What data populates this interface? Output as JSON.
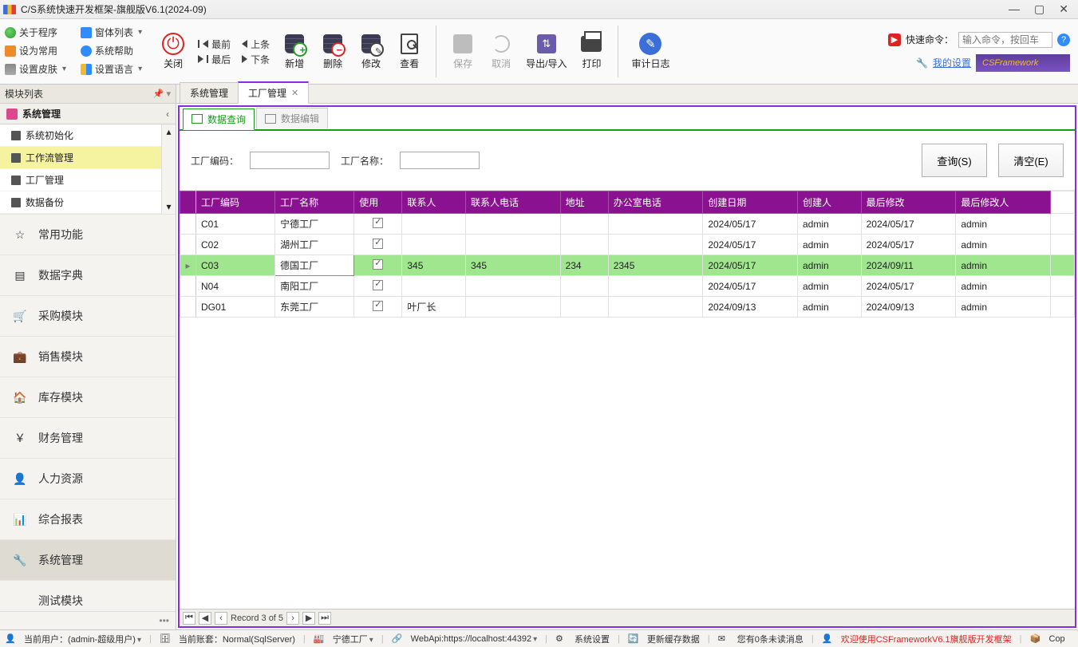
{
  "window": {
    "title": "C/S系统快速开发框架-旗舰版V6.1(2024-09)"
  },
  "menubar": {
    "left": {
      "about": "关于程序",
      "formlist": "窗体列表",
      "setcommon": "设为常用",
      "help": "系统帮助",
      "skin": "设置皮肤",
      "lang": "设置语言"
    },
    "close": "关闭",
    "nav": {
      "first": "最前",
      "prev": "上条",
      "last": "最后",
      "next": "下条"
    },
    "tools": {
      "add": "新增",
      "del": "删除",
      "edit": "修改",
      "view": "查看",
      "save": "保存",
      "cancel": "取消",
      "io": "导出/导入",
      "print": "打印",
      "audit": "审计日志"
    },
    "right": {
      "quickcmd_label": "快速命令：",
      "quickcmd_placeholder": "输入命令，按回车",
      "mysettings": "我的设置",
      "brand": "CSFramework"
    }
  },
  "sidebar": {
    "title": "模块列表",
    "category": "系统管理",
    "tree": [
      "系统初始化",
      "工作流管理",
      "工厂管理",
      "数据备份"
    ],
    "tree_sel": 1,
    "modules": [
      {
        "label": "常用功能",
        "icon": "☆"
      },
      {
        "label": "数据字典",
        "icon": "▤"
      },
      {
        "label": "采购模块",
        "icon": "🛒"
      },
      {
        "label": "销售模块",
        "icon": "💼"
      },
      {
        "label": "库存模块",
        "icon": "🏠"
      },
      {
        "label": "财务管理",
        "icon": "￥"
      },
      {
        "label": "人力资源",
        "icon": "👤"
      },
      {
        "label": "综合报表",
        "icon": "📊"
      },
      {
        "label": "系统管理",
        "icon": "🔧"
      },
      {
        "label": "测试模块",
        "icon": "</>"
      }
    ],
    "active_module": 8
  },
  "tabs": {
    "items": [
      "系统管理",
      "工厂管理"
    ],
    "active": 1
  },
  "subtabs": {
    "query": "数据查询",
    "edit": "数据编辑"
  },
  "search": {
    "code_label": "工厂编码：",
    "name_label": "工厂名称：",
    "query_btn": "查询(S)",
    "clear_btn": "清空(E)"
  },
  "grid": {
    "columns": [
      "工厂编码",
      "工厂名称",
      "使用",
      "联系人",
      "联系人电话",
      "地址",
      "办公室电话",
      "创建日期",
      "创建人",
      "最后修改",
      "最后修改人"
    ],
    "rows": [
      {
        "code": "C01",
        "name": "宁德工厂",
        "use": true,
        "contact": "",
        "phone": "",
        "addr": "",
        "office": "",
        "cdate": "2024/05/17",
        "cby": "admin",
        "mdate": "2024/05/17",
        "mby": "admin",
        "sel": false
      },
      {
        "code": "C02",
        "name": "湖州工厂",
        "use": true,
        "contact": "",
        "phone": "",
        "addr": "",
        "office": "",
        "cdate": "2024/05/17",
        "cby": "admin",
        "mdate": "2024/05/17",
        "mby": "admin",
        "sel": false
      },
      {
        "code": "C03",
        "name": "德国工厂",
        "use": true,
        "contact": "345",
        "phone": "345",
        "addr": "234",
        "office": "2345",
        "cdate": "2024/05/17",
        "cby": "admin",
        "mdate": "2024/09/11",
        "mby": "admin",
        "sel": true
      },
      {
        "code": "N04",
        "name": "南阳工厂",
        "use": true,
        "contact": "",
        "phone": "",
        "addr": "",
        "office": "",
        "cdate": "2024/05/17",
        "cby": "admin",
        "mdate": "2024/05/17",
        "mby": "admin",
        "sel": false
      },
      {
        "code": "DG01",
        "name": "东莞工厂",
        "use": true,
        "contact": "叶厂长",
        "phone": "",
        "addr": "",
        "office": "",
        "cdate": "2024/09/13",
        "cby": "admin",
        "mdate": "2024/09/13",
        "mby": "admin",
        "sel": false
      }
    ]
  },
  "pager": {
    "text": "Record 3 of 5"
  },
  "status": {
    "user": "当前用户：(admin-超级用户)",
    "account": "当前账套：Normal(SqlServer)",
    "factory": "宁德工厂",
    "webapi": "WebApi:https://localhost:44392",
    "syscfg": "系统设置",
    "refresh": "更新缓存数据",
    "msg": "您有0条未读消息",
    "welcome": "欢迎使用CSFrameworkV6.1旗舰版开发框架",
    "cop": "Cop"
  }
}
